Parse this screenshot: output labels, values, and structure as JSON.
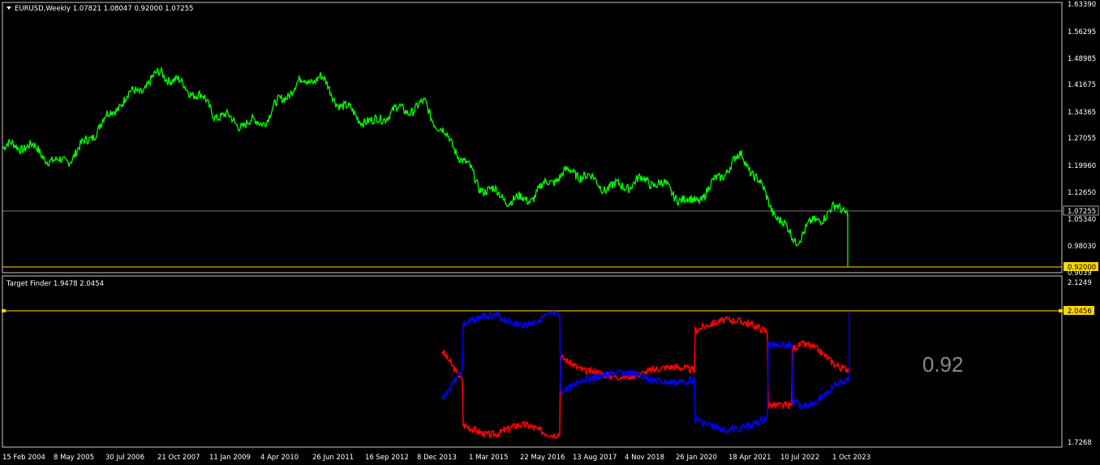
{
  "main_chart": {
    "symbol_line": "EURUSD,Weekly  1.07821 1.08047 0.92000 1.07255",
    "price_ticks": [
      "1.63390",
      "1.56295",
      "1.48985",
      "1.41675",
      "1.34365",
      "1.27055",
      "1.19960",
      "1.12650",
      "1.05340",
      "0.98030"
    ],
    "current_price_label": "1.07255",
    "hline_price_label": "0.92000",
    "partial_tick": "0.9039",
    "series_color": "#00ff00"
  },
  "indicator": {
    "title_line": "Target Finder 1.9478 2.0454",
    "scale_ticks": [
      "2.1249",
      "1.7268"
    ],
    "level_label": "2.0456",
    "big_value": "0.92",
    "colors": {
      "red": "#ff0000",
      "blue": "#0000ff",
      "level": "#ffd700"
    }
  },
  "time_axis": {
    "labels": [
      "15 Feb 2004",
      "8 May 2005",
      "30 Jul 2006",
      "21 Oct 2007",
      "11 Jan 2009",
      "4 Apr 2010",
      "26 Jun 2011",
      "16 Sep 2012",
      "8 Dec 2013",
      "1 Mar 2015",
      "22 May 2016",
      "13 Aug 2017",
      "4 Nov 2018",
      "26 Jan 2020",
      "18 Apr 2021",
      "10 Jul 2022",
      "1 Oct 2023"
    ]
  },
  "chart_data": {
    "type": "line",
    "x": [
      "15 Feb 2004",
      "8 May 2005",
      "30 Jul 2006",
      "21 Oct 2007",
      "11 Jan 2009",
      "4 Apr 2010",
      "26 Jun 2011",
      "16 Sep 2012",
      "8 Dec 2013",
      "1 Mar 2015",
      "22 May 2016",
      "13 Aug 2017",
      "4 Nov 2018",
      "26 Jan 2020",
      "18 Apr 2021",
      "10 Jul 2022",
      "1 Oct 2023"
    ],
    "series": [
      {
        "name": "EURUSD,Weekly",
        "values": [
          1.24,
          1.21,
          1.31,
          1.47,
          1.32,
          1.33,
          1.44,
          1.29,
          1.38,
          1.12,
          1.12,
          1.17,
          1.14,
          1.11,
          1.2,
          1.01,
          1.07
        ]
      }
    ],
    "ylim": [
      0.9039,
      1.6339
    ]
  }
}
